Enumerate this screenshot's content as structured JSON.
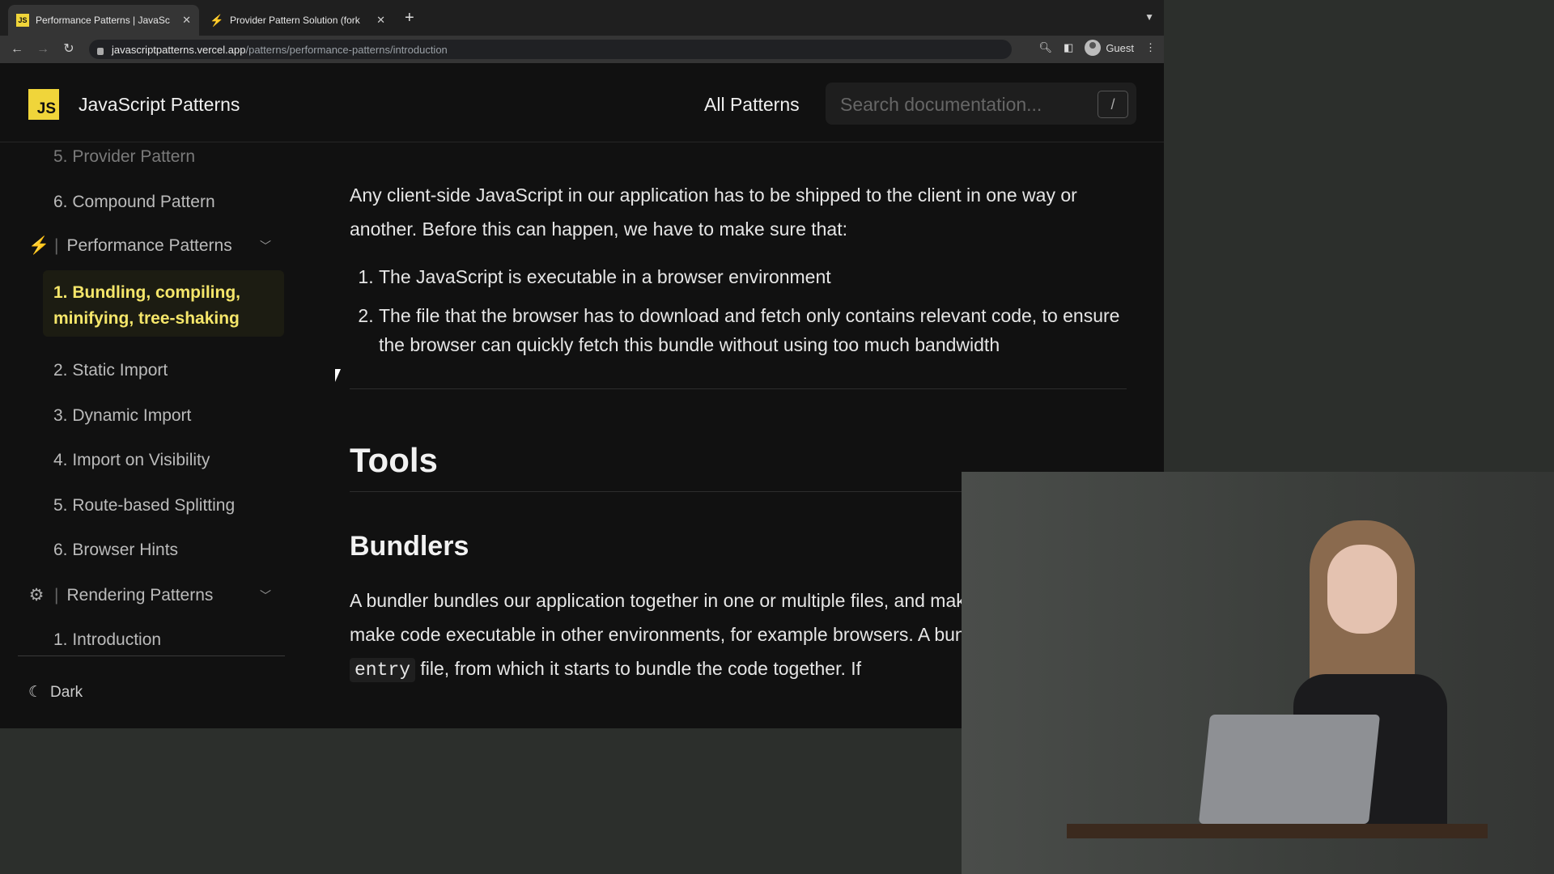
{
  "tabs": [
    {
      "title": "Performance Patterns | JavaSc",
      "favicon": "js-icon",
      "active": true
    },
    {
      "title": "Provider Pattern Solution (fork",
      "favicon": "lightning-icon",
      "active": false
    }
  ],
  "address": {
    "host": "javascriptpatterns.vercel.app",
    "path": "/patterns/performance-patterns/introduction",
    "profile": "Guest"
  },
  "header": {
    "logo": "JS",
    "title": "JavaScript Patterns",
    "all_patterns": "All Patterns",
    "search_placeholder": "Search documentation...",
    "search_key": "/"
  },
  "sidebar": {
    "items_top": [
      {
        "label": "5. Provider Pattern"
      },
      {
        "label": "6. Compound Pattern"
      }
    ],
    "performance_section": "Performance Patterns",
    "active_item": "1. Bundling, compiling, minifying, tree-shaking",
    "performance_items": [
      {
        "label": "2. Static Import"
      },
      {
        "label": "3. Dynamic Import"
      },
      {
        "label": "4. Import on Visibility"
      },
      {
        "label": "5. Route-based Splitting"
      },
      {
        "label": "6. Browser Hints"
      }
    ],
    "rendering_section": "Rendering Patterns",
    "rendering_items": [
      {
        "label": "1. Introduction"
      }
    ],
    "theme_toggle": "Dark"
  },
  "content": {
    "intro": "Any client-side JavaScript in our application has to be shipped to the client in one way or another. Before this can happen, we have to make sure that:",
    "list": [
      "The JavaScript is executable in a browser environment",
      "The file that the browser has to download and fetch only contains relevant code, to ensure the browser can quickly fetch this bundle without using too much bandwidth"
    ],
    "h_tools": "Tools",
    "h_bundlers": "Bundlers",
    "bundler_p1": "A bundler bundles our application together in one or multiple files, and makes it possible to make code executable in other environments, for example browsers. A bundler receives an ",
    "bundler_code": "entry",
    "bundler_p2": " file, from which it starts to bundle the code together. If"
  }
}
